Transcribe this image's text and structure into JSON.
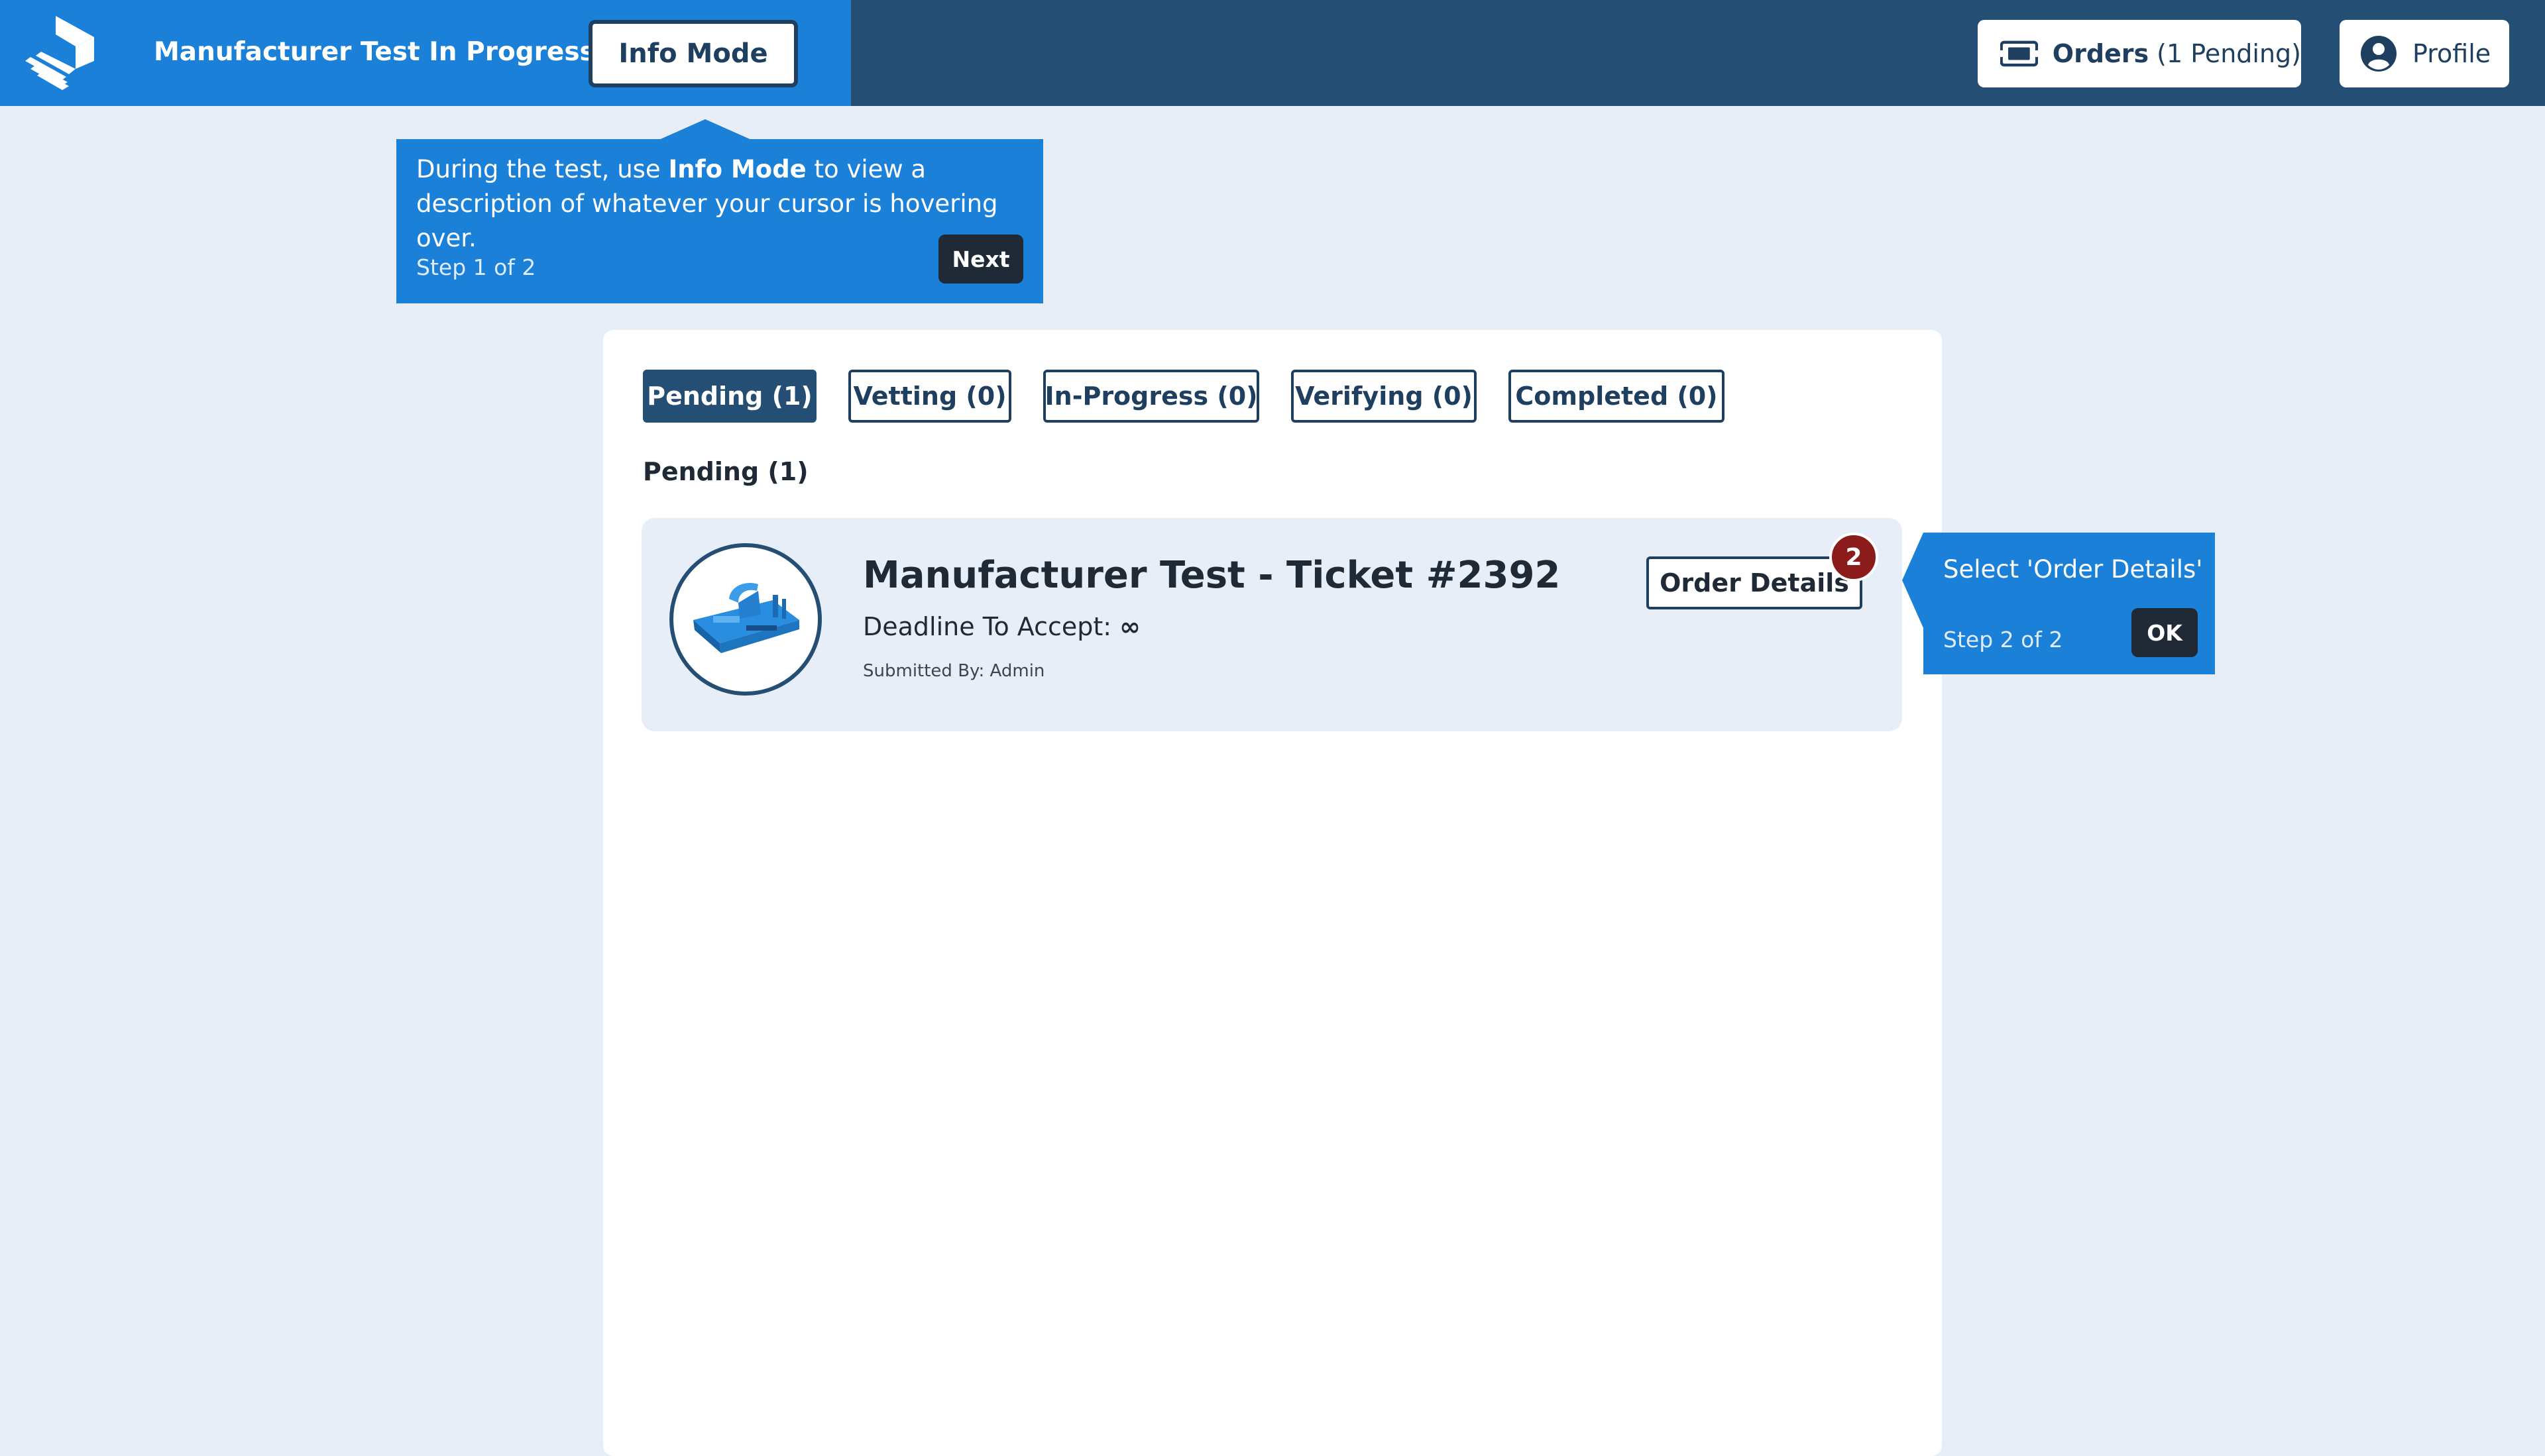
{
  "header": {
    "app_title": "Manufacturer Test In Progress",
    "info_mode_label": "Info Mode",
    "orders_label": "Orders",
    "orders_pending": "(1 Pending)",
    "profile_label": "Profile"
  },
  "tooltip_step1": {
    "text_prefix": "During the test, use ",
    "text_bold": "Info Mode",
    "text_suffix": " to view a description of whatever your cursor is hovering over.",
    "step": "Step 1 of 2",
    "button": "Next"
  },
  "tabs": [
    {
      "label": "Pending (1)",
      "active": true
    },
    {
      "label": "Vetting (0)",
      "active": false
    },
    {
      "label": "In-Progress (0)",
      "active": false
    },
    {
      "label": "Verifying (0)",
      "active": false
    },
    {
      "label": "Completed (0)",
      "active": false
    }
  ],
  "section_title": "Pending (1)",
  "order": {
    "title": "Manufacturer Test - Ticket #2392",
    "deadline_label": "Deadline To Accept:",
    "deadline_value": "∞",
    "submitted_by": "Submitted By: Admin",
    "details_button": "Order Details",
    "badge": "2"
  },
  "tooltip_step2": {
    "text": "Select 'Order Details'",
    "step": "Step 2 of 2",
    "button": "OK"
  },
  "colors": {
    "header_dark": "#254e74",
    "header_accent": "#1a80d8",
    "background": "#e8eef7",
    "badge": "#8c1c1c"
  }
}
